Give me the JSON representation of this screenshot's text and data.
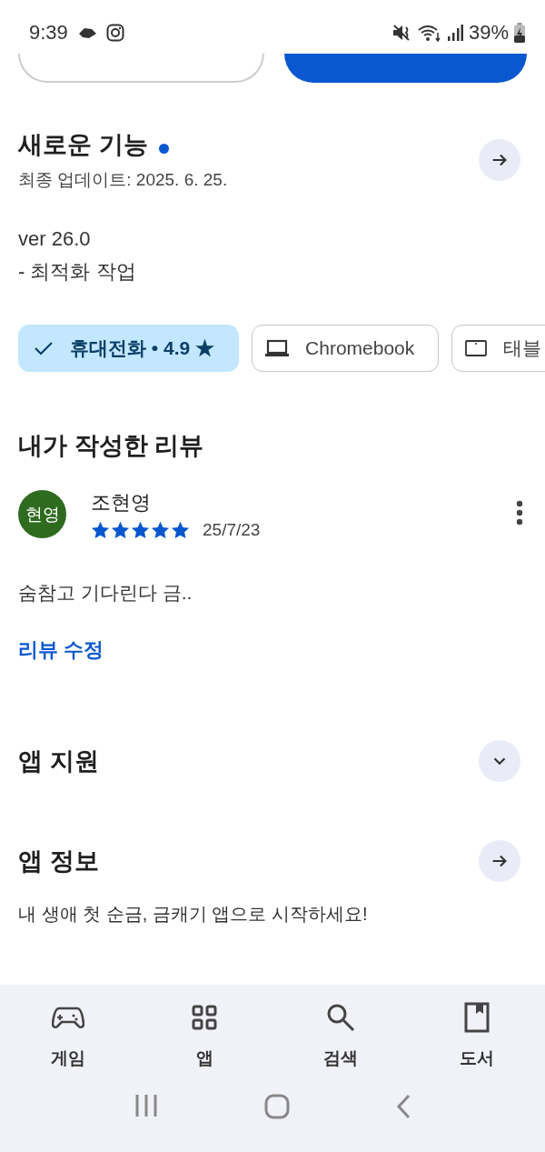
{
  "status_bar": {
    "time": "9:39",
    "battery": "39%"
  },
  "whats_new": {
    "title": "새로운 기능",
    "new_dot": true,
    "updated": "최종 업데이트: 2025. 6. 25.",
    "notes": [
      "ver 26.0",
      "- 최적화 작업"
    ]
  },
  "device_chips": [
    {
      "kind": "phone",
      "label": "휴대전화 • 4.9 ★",
      "selected": true
    },
    {
      "kind": "laptop",
      "label": "Chromebook",
      "selected": false
    },
    {
      "kind": "tablet",
      "label": "태블",
      "selected": false
    }
  ],
  "my_review": {
    "title": "내가 작성한 리뷰",
    "avatar": "현영",
    "author": "조현영",
    "stars": 5,
    "date": "25/7/23",
    "text": "숨참고 기다린다 금..",
    "edit_link": "리뷰 수정"
  },
  "sections": [
    {
      "kind": "expand",
      "title": "앱 지원"
    },
    {
      "kind": "arrow",
      "title": "앱 정보",
      "description": "내 생애 첫 순금, 금캐기 앱으로 시작하세요!"
    }
  ],
  "bottom_nav": [
    {
      "label": "게임"
    },
    {
      "label": "앱"
    },
    {
      "label": "검색"
    },
    {
      "label": "도서"
    }
  ]
}
